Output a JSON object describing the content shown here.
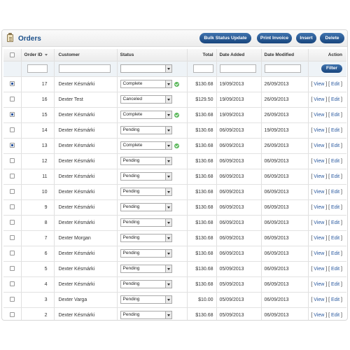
{
  "header": {
    "title": "Orders",
    "buttons": {
      "bulk_status_update": "Bulk Status Update",
      "print_invoice": "Print Invoice",
      "insert": "Insert",
      "delete": "Delete"
    }
  },
  "columns": {
    "order_id": "Order ID",
    "customer": "Customer",
    "status": "Status",
    "total": "Total",
    "date_added": "Date Added",
    "date_modified": "Date Modified",
    "action": "Action"
  },
  "filter": {
    "order_id": "",
    "customer": "",
    "status": "",
    "total": "",
    "date_added": "",
    "date_modified": "",
    "button_label": "Filter"
  },
  "actions": {
    "view": "View",
    "edit": "Edit",
    "open": "[ ",
    "sep": " ] [ ",
    "close": " ]"
  },
  "colors": {
    "accent": "#1b4f8a",
    "button": "#224f88",
    "ok": "#5cb85c",
    "link": "#2a5aa0"
  },
  "rows": [
    {
      "checked": true,
      "order_id": "17",
      "customer": "Dexter Késmárki",
      "status": "Complete",
      "complete_icon": true,
      "total": "$130.68",
      "date_added": "19/09/2013",
      "date_modified": "26/09/2013"
    },
    {
      "checked": false,
      "order_id": "16",
      "customer": "Dexter Test",
      "status": "Canceled",
      "complete_icon": false,
      "total": "$129.50",
      "date_added": "19/09/2013",
      "date_modified": "26/09/2013"
    },
    {
      "checked": true,
      "order_id": "15",
      "customer": "Dexter Késmárki",
      "status": "Complete",
      "complete_icon": true,
      "total": "$130.68",
      "date_added": "19/09/2013",
      "date_modified": "26/09/2013"
    },
    {
      "checked": false,
      "order_id": "14",
      "customer": "Dexter Késmárki",
      "status": "Pending",
      "complete_icon": false,
      "total": "$130.68",
      "date_added": "06/09/2013",
      "date_modified": "19/09/2013"
    },
    {
      "checked": true,
      "order_id": "13",
      "customer": "Dexter Késmárki",
      "status": "Complete",
      "complete_icon": true,
      "total": "$130.68",
      "date_added": "06/09/2013",
      "date_modified": "26/09/2013"
    },
    {
      "checked": false,
      "order_id": "12",
      "customer": "Dexter Késmárki",
      "status": "Pending",
      "complete_icon": false,
      "total": "$130.68",
      "date_added": "06/09/2013",
      "date_modified": "06/09/2013"
    },
    {
      "checked": false,
      "order_id": "11",
      "customer": "Dexter Késmárki",
      "status": "Pending",
      "complete_icon": false,
      "total": "$130.68",
      "date_added": "06/09/2013",
      "date_modified": "06/09/2013"
    },
    {
      "checked": false,
      "order_id": "10",
      "customer": "Dexter Késmárki",
      "status": "Pending",
      "complete_icon": false,
      "total": "$130.68",
      "date_added": "06/09/2013",
      "date_modified": "06/09/2013"
    },
    {
      "checked": false,
      "order_id": "9",
      "customer": "Dexter Késmárki",
      "status": "Pending",
      "complete_icon": false,
      "total": "$130.68",
      "date_added": "06/09/2013",
      "date_modified": "06/09/2013"
    },
    {
      "checked": false,
      "order_id": "8",
      "customer": "Dexter Késmárki",
      "status": "Pending",
      "complete_icon": false,
      "total": "$130.68",
      "date_added": "06/09/2013",
      "date_modified": "06/09/2013"
    },
    {
      "checked": false,
      "order_id": "7",
      "customer": "Dexter Morgan",
      "status": "Pending",
      "complete_icon": false,
      "total": "$130.68",
      "date_added": "06/09/2013",
      "date_modified": "06/09/2013"
    },
    {
      "checked": false,
      "order_id": "6",
      "customer": "Dexter Késmárki",
      "status": "Pending",
      "complete_icon": false,
      "total": "$130.68",
      "date_added": "06/09/2013",
      "date_modified": "06/09/2013"
    },
    {
      "checked": false,
      "order_id": "5",
      "customer": "Dexter Késmárki",
      "status": "Pending",
      "complete_icon": false,
      "total": "$130.68",
      "date_added": "05/09/2013",
      "date_modified": "06/09/2013"
    },
    {
      "checked": false,
      "order_id": "4",
      "customer": "Dexter Késmárki",
      "status": "Pending",
      "complete_icon": false,
      "total": "$130.68",
      "date_added": "05/09/2013",
      "date_modified": "06/09/2013"
    },
    {
      "checked": false,
      "order_id": "3",
      "customer": "Dexter Varga",
      "status": "Pending",
      "complete_icon": false,
      "total": "$10.00",
      "date_added": "05/09/2013",
      "date_modified": "06/09/2013"
    },
    {
      "checked": false,
      "order_id": "2",
      "customer": "Dexter Késmárki",
      "status": "Pending",
      "complete_icon": false,
      "total": "$130.68",
      "date_added": "05/09/2013",
      "date_modified": "06/09/2013"
    }
  ]
}
